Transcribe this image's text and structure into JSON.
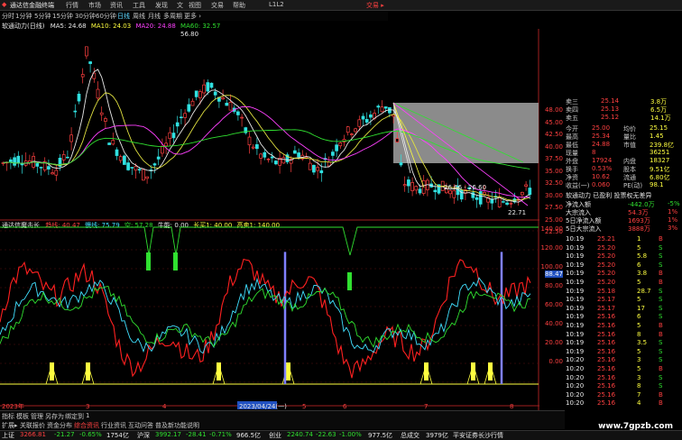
{
  "titlebar": {
    "app_title": "通达信金融终端",
    "menus": [
      "行情",
      "市场",
      "资讯",
      "工具",
      "发现",
      "文",
      "视图",
      "交易",
      "帮助",
      "L1L2"
    ],
    "trade_label": "交易 ▸"
  },
  "period_tabs": [
    {
      "label": "分时",
      "active": false
    },
    {
      "label": "1分钟",
      "active": false
    },
    {
      "label": "5分钟",
      "active": false
    },
    {
      "label": "15分钟",
      "active": false
    },
    {
      "label": "30分钟",
      "active": false
    },
    {
      "label": "60分钟",
      "active": false
    },
    {
      "label": "日线",
      "active": true
    },
    {
      "label": "周线",
      "active": false
    },
    {
      "label": "月线",
      "active": false
    },
    {
      "label": "多周期",
      "active": false
    },
    {
      "label": "更多 ›",
      "active": false
    }
  ],
  "ma_legend": {
    "name": "软通动力(日线)",
    "ma5": "MA5: 24.68",
    "ma10": "MA10: 24.03",
    "ma20": "MA20: 24.88",
    "ma60": "MA60: 32.57"
  },
  "price_annotations": {
    "high": "56.80",
    "low": "22.71",
    "mid": "26.66 - 26.60"
  },
  "indicator_legend": {
    "name": "通达信魔击长",
    "a": "趋线: 40.47",
    "b": "慢线: 75.79",
    "c": "空: 57.28",
    "d": "牛能: 0.00",
    "e": "长买1: 40.00",
    "f": "高卖1: 140.00"
  },
  "right_axis_top": [
    "48.00",
    "45.00",
    "42.50",
    "40.00",
    "37.50",
    "35.00",
    "32.50",
    "30.00",
    "27.50",
    "25.00",
    "22.50"
  ],
  "right_axis_bottom": [
    "140.00",
    "120.00",
    "100.00",
    "80.00",
    "60.00",
    "40.00",
    "20.00",
    "0.00"
  ],
  "axis_highlight": "88.47",
  "time_axis": [
    "2023年",
    "3",
    "4",
    "2023/04/24(一)",
    "5",
    "6",
    "7",
    "8"
  ],
  "quote": {
    "asks": [
      {
        "label": "卖三",
        "price": "25.14",
        "vol": "3.8万"
      },
      {
        "label": "卖四",
        "price": "25.13",
        "vol": "6.5万"
      },
      {
        "label": "卖五",
        "price": "25.12",
        "vol": "14.1万"
      }
    ],
    "stats": [
      {
        "l1": "今开",
        "v1": "25.00",
        "l2": "均价",
        "v2": "25.15"
      },
      {
        "l1": "最高",
        "v1": "25.34",
        "l2": "量比",
        "v2": "1.45"
      },
      {
        "l1": "最低",
        "v1": "24.88",
        "l2": "市值",
        "v2": "239.8亿"
      },
      {
        "l1": "现量",
        "v1": "8",
        "l2": "",
        "v2": "36251"
      },
      {
        "l1": "外盘",
        "v1": "17924",
        "l2": "内盘",
        "v2": "18327"
      },
      {
        "l1": "换手",
        "v1": "0.53%",
        "l2": "股本",
        "v2": "9.51亿"
      },
      {
        "l1": "净资",
        "v1": "10.62",
        "l2": "流通",
        "v2": "6.80亿"
      },
      {
        "l1": "收益(一)",
        "v1": "0.060",
        "l2": "PE(动)",
        "v2": "98.1"
      }
    ],
    "news": "软通动力 已盈利 投票权无差异",
    "flows": [
      {
        "label": "净流入额",
        "v": "-442.0万",
        "p": "-5%"
      },
      {
        "label": "大宗流入",
        "v": "54.3万",
        "p": "1%"
      },
      {
        "label": "5日净流入额",
        "v": "1693万",
        "p": "1%"
      },
      {
        "label": "5日大宗流入",
        "v": "3888万",
        "p": "3%"
      }
    ],
    "ticks": [
      {
        "t": "10:19",
        "p": "25.21",
        "v": "1",
        "f": "B"
      },
      {
        "t": "10:19",
        "p": "25.20",
        "v": "5",
        "f": "S"
      },
      {
        "t": "10:19",
        "p": "25.20",
        "v": "5.8",
        "f": "S"
      },
      {
        "t": "10:19",
        "p": "25.20",
        "v": "6",
        "f": "S"
      },
      {
        "t": "10:19",
        "p": "25.20",
        "v": "3.8",
        "f": "B"
      },
      {
        "t": "10:19",
        "p": "25.20",
        "v": "5",
        "f": "B"
      },
      {
        "t": "10:19",
        "p": "25.18",
        "v": "28.7",
        "f": "S"
      },
      {
        "t": "10:19",
        "p": "25.17",
        "v": "5",
        "f": "S"
      },
      {
        "t": "10:19",
        "p": "25.17",
        "v": "17",
        "f": "S"
      },
      {
        "t": "10:19",
        "p": "25.16",
        "v": "6",
        "f": "S"
      },
      {
        "t": "10:19",
        "p": "25.16",
        "v": "5",
        "f": "B"
      },
      {
        "t": "10:19",
        "p": "25.16",
        "v": "8",
        "f": "B"
      },
      {
        "t": "10:19",
        "p": "25.16",
        "v": "3.5",
        "f": "S"
      },
      {
        "t": "10:19",
        "p": "25.16",
        "v": "5",
        "f": "S"
      },
      {
        "t": "10:20",
        "p": "25.16",
        "v": "3",
        "f": "S"
      },
      {
        "t": "10:20",
        "p": "25.16",
        "v": "5",
        "f": "B"
      },
      {
        "t": "10:20",
        "p": "25.16",
        "v": "3",
        "f": "S"
      },
      {
        "t": "10:20",
        "p": "25.16",
        "v": "8",
        "f": "S"
      },
      {
        "t": "10:20",
        "p": "25.16",
        "v": "7",
        "f": "B"
      },
      {
        "t": "10:20",
        "p": "25.16",
        "v": "4",
        "f": "B"
      }
    ]
  },
  "bottom_tabs": [
    "指标",
    "模板",
    "管理",
    "另存为",
    "绑定到",
    "1"
  ],
  "bottom_tabs2": [
    "扩展▸",
    "关联报价",
    "资金分布",
    "综合资讯",
    "行业资讯",
    "互动问答",
    "普及新功能说明"
  ],
  "status": {
    "sh_label": "上证",
    "sh_val": "3266.81",
    "sh_chg": "-21.27",
    "sh_pct": "-0.65%",
    "sh_amt": "1754亿",
    "sz_label": "沪深",
    "sz_val": "3992.17",
    "sz_chg": "-28.41",
    "sz_pct": "-0.71%",
    "sz_amt": "966.5亿",
    "cy_label": "创业",
    "cy_val": "2240.74",
    "cy_chg": "-22.63",
    "cy_pct": "-1.00%",
    "cy_amt": "977.5亿",
    "total_label": "总成交",
    "total_val": "3979亿",
    "msg": "平安证券长沙行情"
  },
  "watermark": "www.7gpzb.com",
  "colors": {
    "up": "#ff4040",
    "down": "#30e0e0",
    "ma5": "#e8e8e8",
    "ma10": "#e0e040",
    "ma20": "#ff40ff",
    "ma60": "#30e030"
  }
}
